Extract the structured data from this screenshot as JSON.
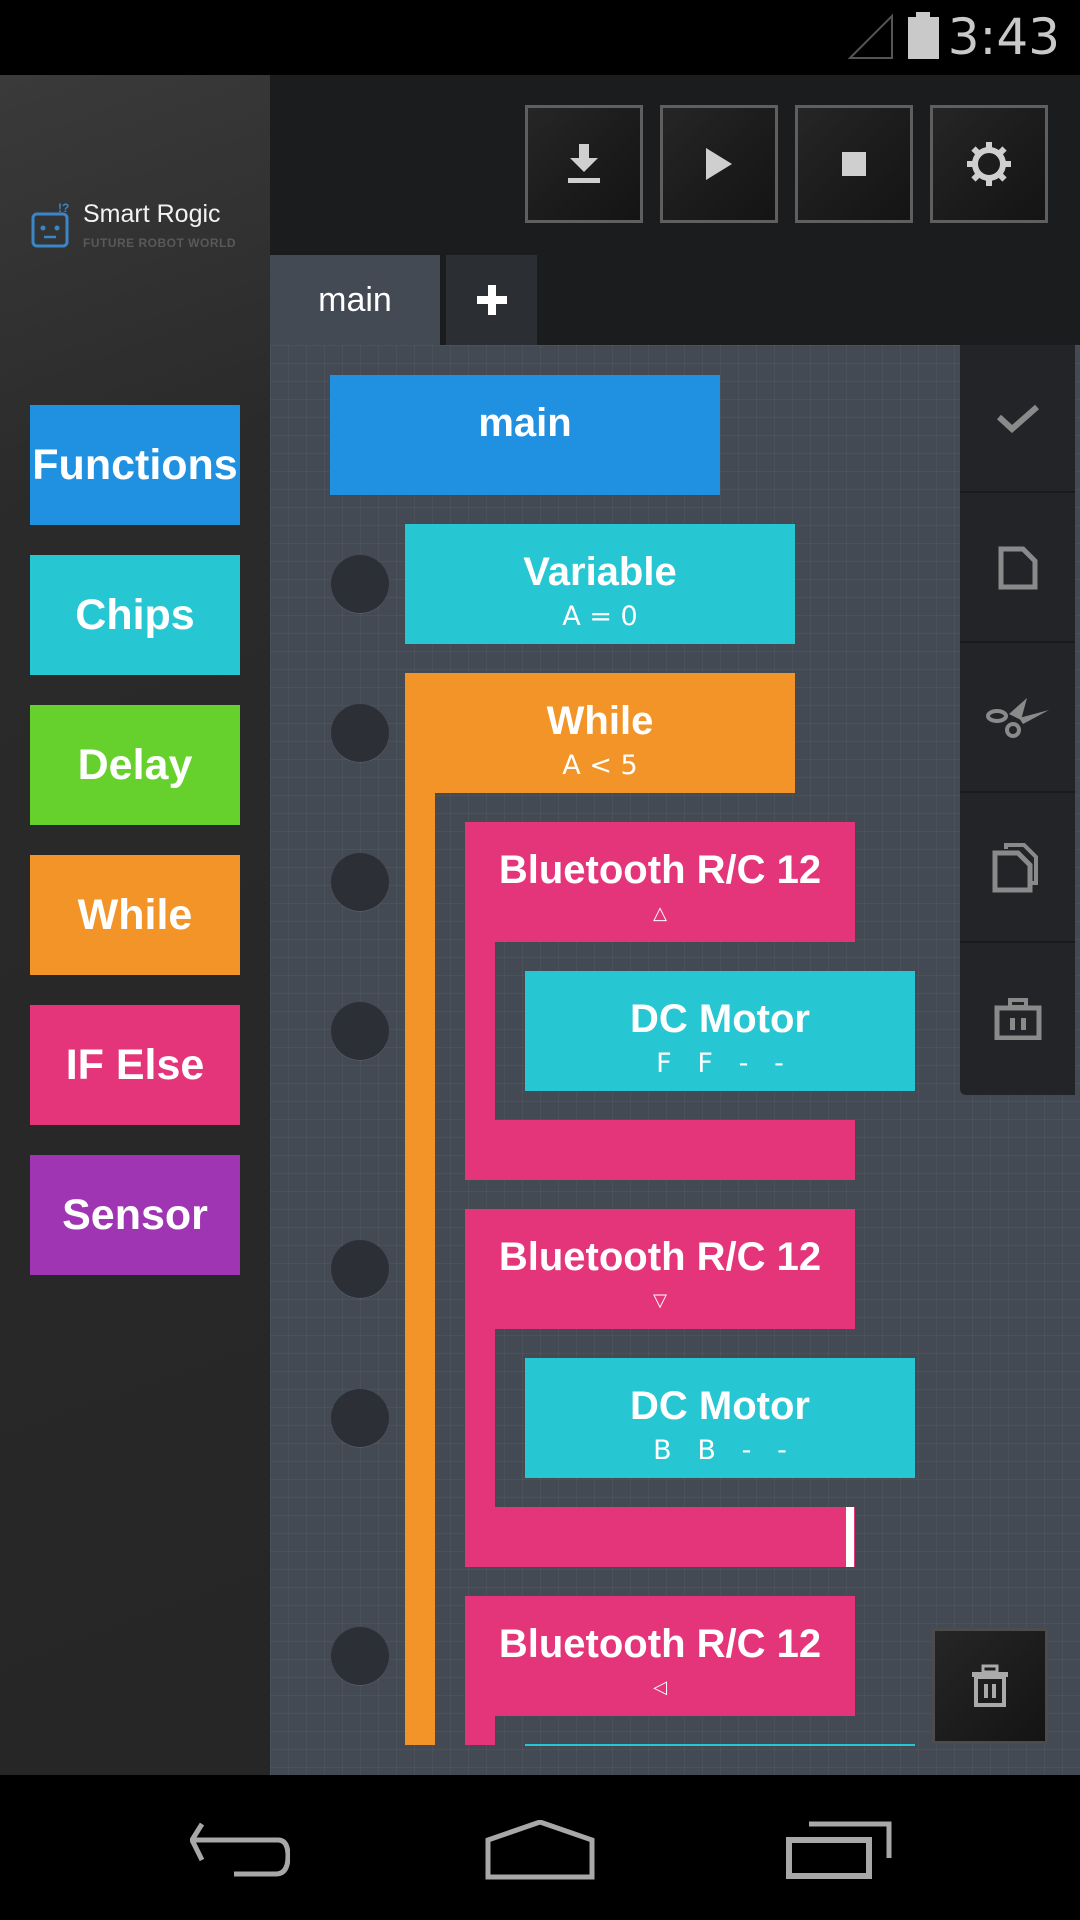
{
  "status_bar": {
    "time": "3:43",
    "icons": [
      "signal-icon",
      "battery-icon"
    ]
  },
  "app": {
    "logo_title": "Smart Rogic",
    "logo_subtitle": "FUTURE ROBOT WORLD"
  },
  "categories": [
    {
      "label": "Functions",
      "color": "#2090e0"
    },
    {
      "label": "Chips",
      "color": "#26c6d2"
    },
    {
      "label": "Delay",
      "color": "#66d02c"
    },
    {
      "label": "While",
      "color": "#f29427"
    },
    {
      "label": "IF Else",
      "color": "#e5357a"
    },
    {
      "label": "Sensor",
      "color": "#a035b3"
    }
  ],
  "toolbar": {
    "buttons": [
      "download-icon",
      "play-icon",
      "stop-icon",
      "settings-icon"
    ]
  },
  "tabs": {
    "active": "main",
    "add_label": "+"
  },
  "side_actions": [
    "check-icon",
    "new-file-icon",
    "cut-icon",
    "copy-icon",
    "delete-icon"
  ],
  "program": {
    "main_block": {
      "title": "main",
      "color": "#2090e0"
    },
    "blocks": [
      {
        "title": "Variable",
        "sub": "A = 0",
        "color": "#26c6d2"
      },
      {
        "title": "While",
        "sub": "A  <  5",
        "color": "#f29427"
      },
      {
        "title": "Bluetooth R/C 12",
        "sub": "△",
        "color": "#e5357a"
      },
      {
        "title": "DC Motor",
        "sub": "F   F   -   -",
        "color": "#26c6d2"
      },
      {
        "title": "Bluetooth R/C 12",
        "sub": "▽",
        "color": "#e5357a"
      },
      {
        "title": "DC Motor",
        "sub": "B   B   -   -",
        "color": "#26c6d2"
      },
      {
        "title": "Bluetooth R/C 12",
        "sub": "◁",
        "color": "#e5357a"
      }
    ]
  },
  "nav_bar": [
    "back-icon",
    "home-icon",
    "recents-icon"
  ]
}
